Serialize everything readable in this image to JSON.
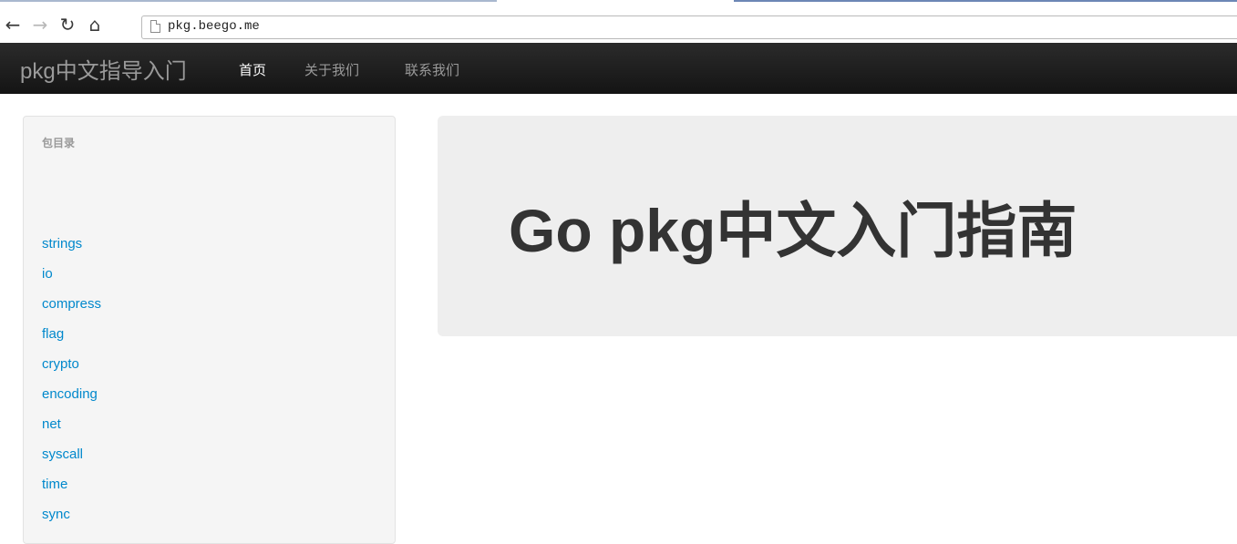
{
  "browser": {
    "url": "pkg.beego.me",
    "icons": [
      "back-arrow-icon",
      "forward-arrow-icon",
      "reload-icon",
      "home-icon",
      "page-icon"
    ]
  },
  "navbar": {
    "brand": "pkg中文指导入门",
    "items": [
      {
        "label": "首页",
        "active": true
      },
      {
        "label": "关于我们",
        "active": false
      },
      {
        "label": "联系我们",
        "active": false
      }
    ]
  },
  "sidebar": {
    "header": "包目录",
    "packages": [
      "strings",
      "io",
      "compress",
      "flag",
      "crypto",
      "encoding",
      "net",
      "syscall",
      "time",
      "sync"
    ]
  },
  "hero": {
    "title": "Go pkg中文入门指南"
  },
  "colors": {
    "link": "#0088cc",
    "navbar_bg": "#1b1b1b",
    "hero_bg": "#eeeeee",
    "sidebar_bg": "#f5f5f5"
  }
}
